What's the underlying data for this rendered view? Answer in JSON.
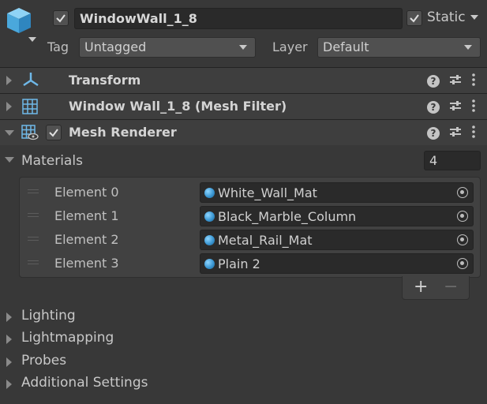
{
  "header": {
    "object_name": "WindowWall_1_8",
    "static_label": "Static",
    "active_checked": true,
    "static_checked": true,
    "tag_label": "Tag",
    "tag_value": "Untagged",
    "layer_label": "Layer",
    "layer_value": "Default"
  },
  "components": [
    {
      "title": "Transform",
      "icon": "transform-icon",
      "expanded": false
    },
    {
      "title": "Window Wall_1_8 (Mesh Filter)",
      "icon": "mesh-filter-icon",
      "expanded": false
    },
    {
      "title": "Mesh Renderer",
      "icon": "mesh-renderer-icon",
      "expanded": true,
      "enabled": true
    }
  ],
  "materials": {
    "label": "Materials",
    "count": "4",
    "elements": [
      {
        "label": "Element 0",
        "value": "White_Wall_Mat"
      },
      {
        "label": "Element 1",
        "value": "Black_Marble_Column"
      },
      {
        "label": "Element 2",
        "value": "Metal_Rail_Mat"
      },
      {
        "label": "Element 3",
        "value": "Plain 2"
      }
    ],
    "add_label": "+",
    "remove_label": "−"
  },
  "sections": [
    {
      "label": "Lighting"
    },
    {
      "label": "Lightmapping"
    },
    {
      "label": "Probes"
    },
    {
      "label": "Additional Settings"
    }
  ],
  "icons": {
    "help": "?"
  },
  "colors": {
    "background": "#383838",
    "header_bg": "#3e3e3e",
    "field_bg": "#2a2a2a",
    "accent_blue": "#3b97d3"
  }
}
